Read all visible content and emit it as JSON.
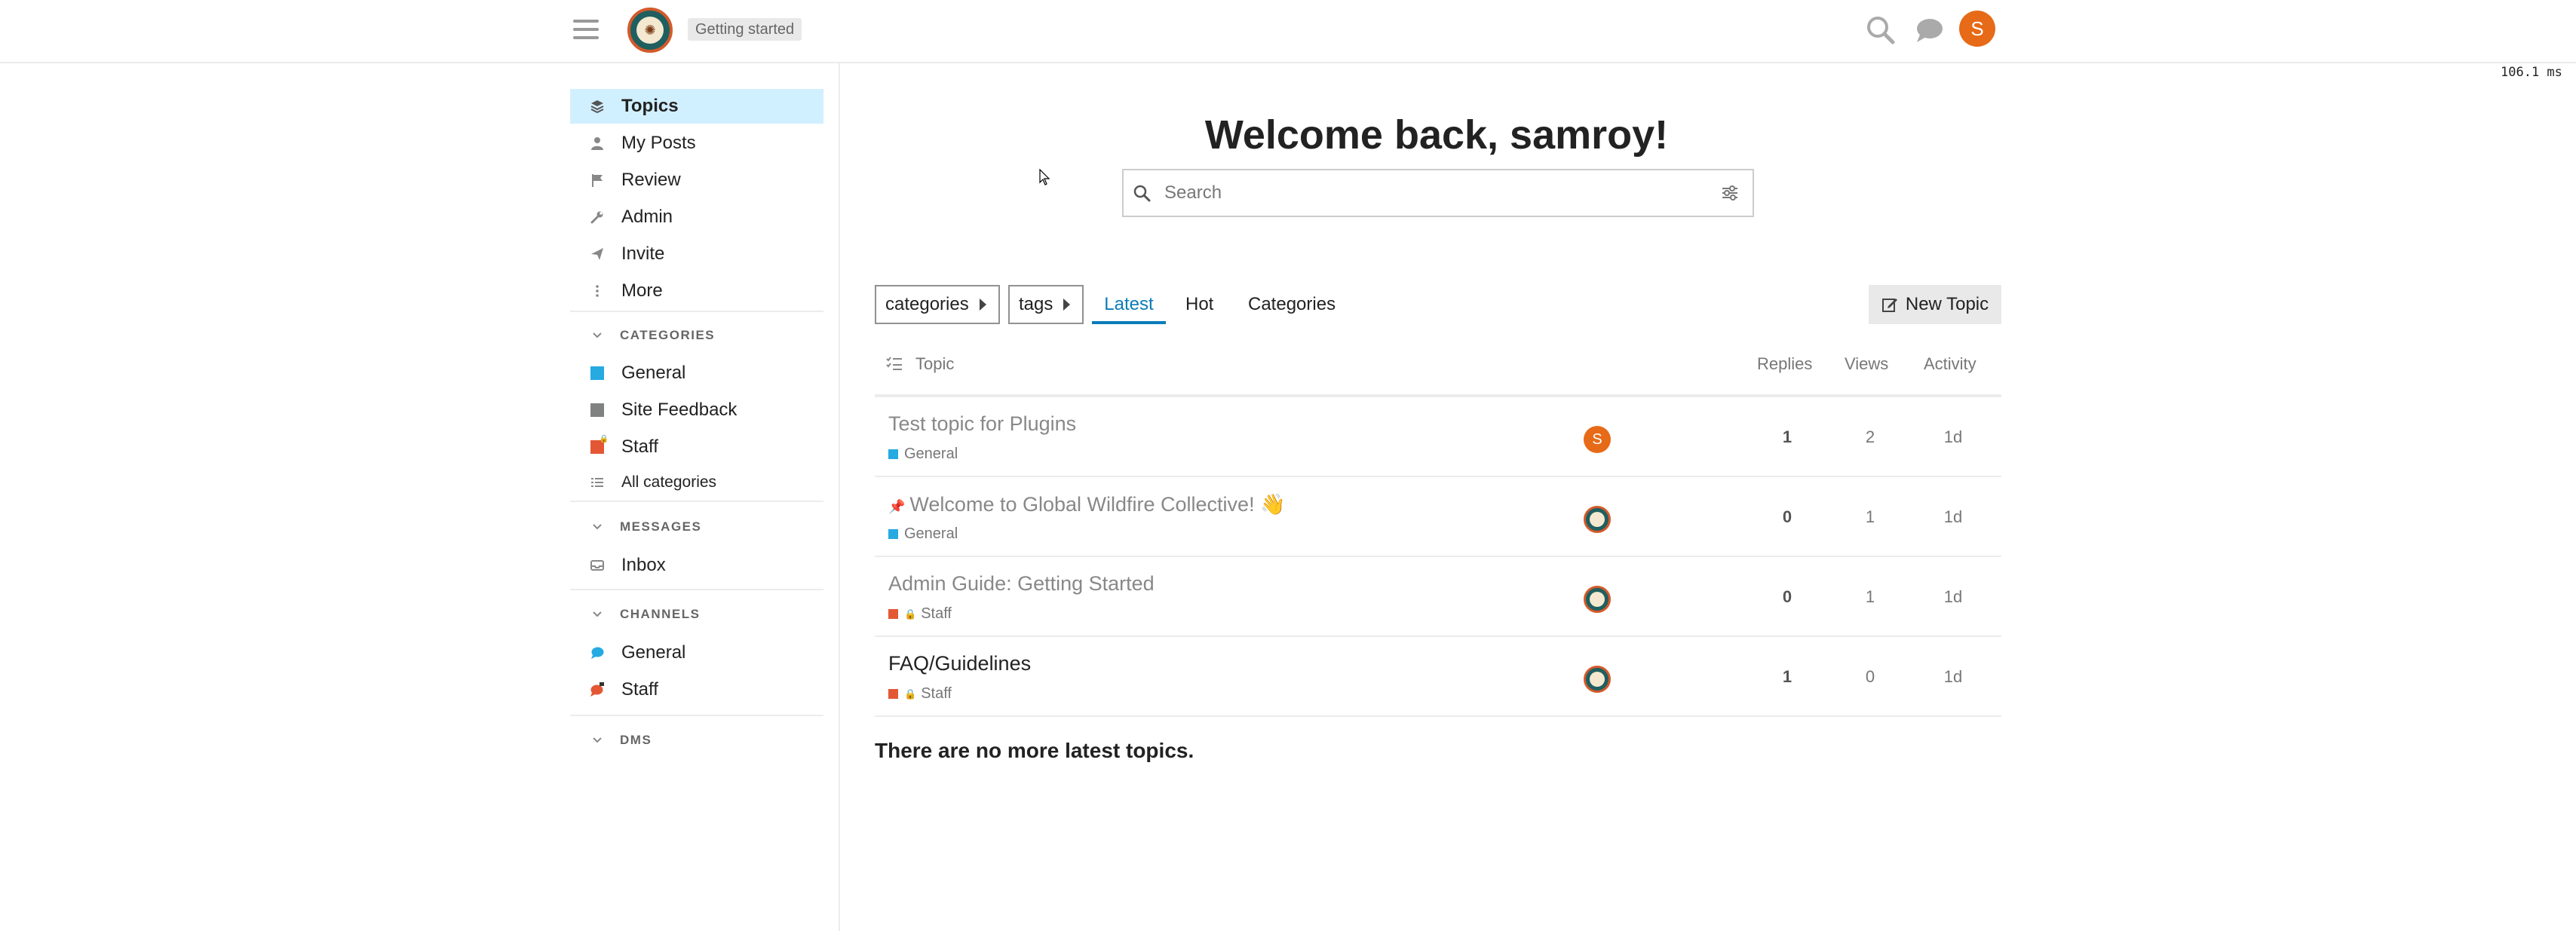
{
  "header": {
    "getting_started": "Getting started",
    "timing": "106.1 ms",
    "user_initial": "S",
    "icons": [
      "hamburger-icon",
      "site-logo",
      "search-icon",
      "chat-icon",
      "user-avatar"
    ]
  },
  "sidebar": {
    "nav": [
      {
        "label": "Topics",
        "icon": "topics-icon",
        "active": true
      },
      {
        "label": "My Posts",
        "icon": "user-icon"
      },
      {
        "label": "Review",
        "icon": "flag-icon"
      },
      {
        "label": "Admin",
        "icon": "wrench-icon"
      },
      {
        "label": "Invite",
        "icon": "paper-plane-icon"
      },
      {
        "label": "More",
        "icon": "ellipsis-vertical-icon"
      }
    ],
    "categories_header": "CATEGORIES",
    "categories": [
      {
        "label": "General",
        "color": "#25AAE2"
      },
      {
        "label": "Site Feedback",
        "color": "#808281"
      },
      {
        "label": "Staff",
        "color": "#E45735",
        "locked": true
      }
    ],
    "all_categories": "All categories",
    "messages_header": "MESSAGES",
    "inbox": "Inbox",
    "channels_header": "CHANNELS",
    "channels": [
      {
        "label": "General",
        "color": "#25AAE2"
      },
      {
        "label": "Staff",
        "color": "#E45735",
        "locked": true
      }
    ],
    "dms_header": "DMS"
  },
  "main": {
    "welcome": "Welcome back, samroy!",
    "search_placeholder": "Search",
    "filters": {
      "categories": "categories",
      "tags": "tags"
    },
    "tabs": [
      {
        "label": "Latest",
        "active": true
      },
      {
        "label": "Hot"
      },
      {
        "label": "Categories"
      }
    ],
    "new_topic": "New Topic",
    "columns": {
      "topic": "Topic",
      "replies": "Replies",
      "views": "Views",
      "activity": "Activity"
    },
    "topics": [
      {
        "title": "Test topic for Plugins",
        "category": "General",
        "cat_color": "#25AAE2",
        "locked": false,
        "pinned": false,
        "poster": "S",
        "replies": "1",
        "views": "2",
        "activity": "1d",
        "unread": false
      },
      {
        "title": "Welcome to Global Wildfire Collective! 👋",
        "category": "General",
        "cat_color": "#25AAE2",
        "locked": false,
        "pinned": true,
        "poster": "logo",
        "replies": "0",
        "views": "1",
        "activity": "1d",
        "unread": false
      },
      {
        "title": "Admin Guide: Getting Started",
        "category": "Staff",
        "cat_color": "#E45735",
        "locked": true,
        "pinned": false,
        "poster": "logo",
        "replies": "0",
        "views": "1",
        "activity": "1d",
        "unread": false
      },
      {
        "title": "FAQ/Guidelines",
        "category": "Staff",
        "cat_color": "#E45735",
        "locked": true,
        "pinned": false,
        "poster": "logo",
        "replies": "1",
        "views": "0",
        "activity": "1d",
        "unread": true
      }
    ],
    "no_more": "There are no more latest topics."
  }
}
